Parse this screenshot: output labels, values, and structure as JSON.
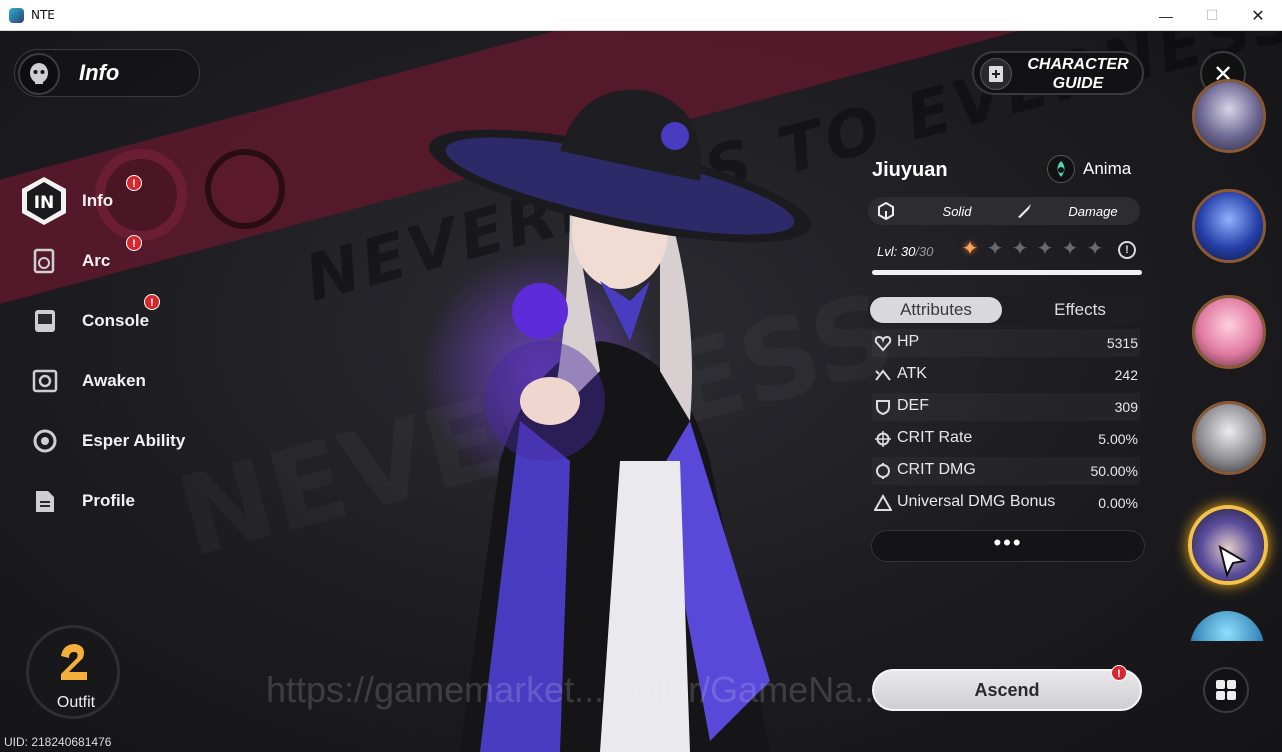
{
  "window": {
    "title": "NTE",
    "minimize": "—",
    "maximize": "☐",
    "close": "✕"
  },
  "header": {
    "title": "Info"
  },
  "nav": [
    {
      "label": "Info",
      "icon": "info-logo-icon",
      "badge": "!"
    },
    {
      "label": "Arc",
      "icon": "arc-icon",
      "badge": "!"
    },
    {
      "label": "Console",
      "icon": "console-icon",
      "badge": "!"
    },
    {
      "label": "Awaken",
      "icon": "awaken-icon"
    },
    {
      "label": "Esper Ability",
      "icon": "esper-icon"
    },
    {
      "label": "Profile",
      "icon": "profile-icon"
    }
  ],
  "outfit": {
    "label": "Outfit"
  },
  "uid": "UID: 218240681476",
  "guide": {
    "line1": "CHARACTER",
    "line2": "GUIDE"
  },
  "character": {
    "name": "Jiuyuan",
    "attribute": "Anima",
    "type_1": "Solid",
    "type_2": "Damage",
    "level_prefix": "Lvl: ",
    "level": "30",
    "level_max": "/30",
    "stars_lit": 1,
    "stars_total": 6,
    "xp_fraction": 1.0
  },
  "tabs": {
    "attributes": "Attributes",
    "effects": "Effects"
  },
  "stats": [
    {
      "name": "HP",
      "value": "5315",
      "icon": "heart-icon"
    },
    {
      "name": "ATK",
      "value": "242",
      "icon": "atk-icon"
    },
    {
      "name": "DEF",
      "value": "309",
      "icon": "shield-icon"
    },
    {
      "name": "CRIT Rate",
      "value": "5.00%",
      "icon": "crosshair-icon"
    },
    {
      "name": "CRIT DMG",
      "value": "50.00%",
      "icon": "crit-dmg-icon"
    },
    {
      "name": "Universal DMG Bonus",
      "value": "0.00%",
      "icon": "triangle-icon"
    }
  ],
  "more_label": "•••",
  "ascend": {
    "label": "Ascend",
    "badge": "!"
  },
  "watermark": "https://gamemarket... seller/GameNa...",
  "background_text": {
    "band": "NEVERNESS TO EVERNESS"
  },
  "colors": {
    "accent_band": "#5a1a2c",
    "badge": "#d8262e",
    "selected_ring": "#f4c24a",
    "star_on": "#f7a35a"
  }
}
